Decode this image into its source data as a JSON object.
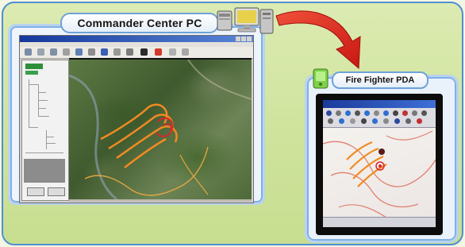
{
  "commander": {
    "title": "Commander Center PC"
  },
  "field_unit": {
    "title": "Fire Fighter PDA"
  },
  "colors": {
    "frame_border": "#4f8fd0",
    "frame_fill": "#d3e5a3",
    "arrow": "#e0201a",
    "fire_line": "#f08a22",
    "fire_line_dark": "#d8262a",
    "pda_contour": "#e08070"
  },
  "icons": {
    "pc_icon": "desktop-computer-icon",
    "pda_icon": "handheld-device-icon",
    "arrow": "curved-arrow-icon"
  }
}
